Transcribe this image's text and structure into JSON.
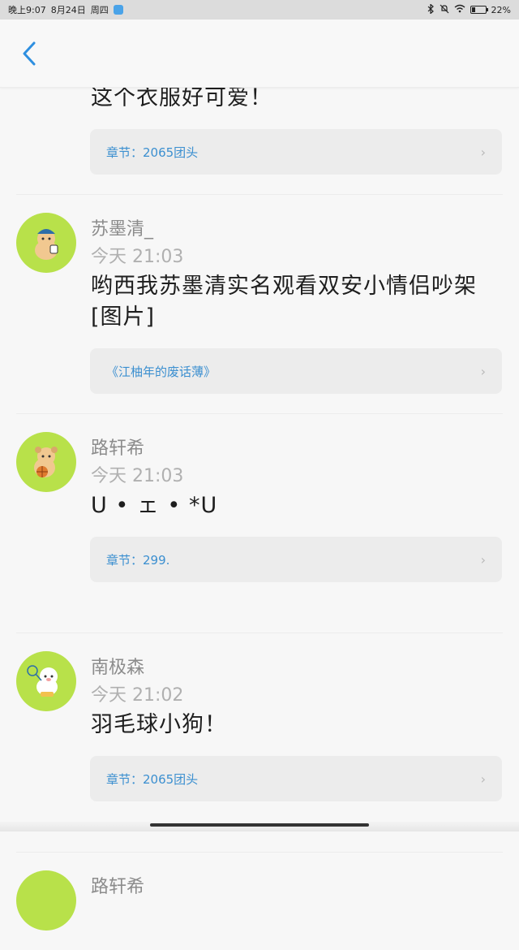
{
  "status_bar": {
    "time": "晚上9:07",
    "date": "8月24日",
    "weekday": "周四",
    "battery": "22%",
    "battery_level": 0.22
  },
  "comments": [
    {
      "text": "这个衣服好可爱！",
      "source": "章节：2065团头"
    },
    {
      "name": "苏墨清_",
      "time": "今天 21:03",
      "text": "哟西我苏墨清实名观看双安小情侣吵架[图片]",
      "source": "《江柚年的废话薄》"
    },
    {
      "name": "路轩希",
      "time": "今天 21:03",
      "text": "U • ェ • *U",
      "source": "章节：299."
    },
    {
      "name": "南极森",
      "time": "今天 21:02",
      "text": "羽毛球小狗！",
      "source": "章节：2065团头"
    },
    {
      "name": "路轩希"
    }
  ],
  "colors": {
    "avatar": "#b8e14a",
    "link": "#3b8fd0",
    "back_icon": "#2e8fe0"
  }
}
